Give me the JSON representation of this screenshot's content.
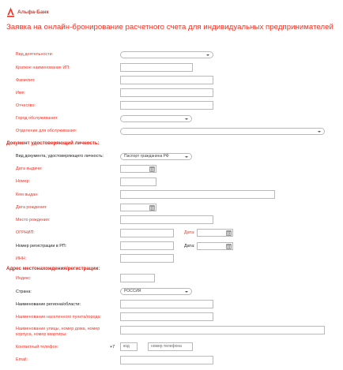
{
  "brand": {
    "name": "Альфа-Банк",
    "accent": "#ef3124"
  },
  "title": "Заявка на онлайн-бронирование расчетного счета для индивидуальных предпринимателей",
  "labels": {
    "activity": "Вид деятельности:",
    "short_name": "Краткое наименование ИП:",
    "surname": "Фамилия:",
    "name": "Имя:",
    "patronymic": "Отчество:",
    "city": "Город обслуживания:",
    "branch": "Отделение для обслуживания:",
    "id_section": "Документ удостоверяющий личность:",
    "doc_type": "Вид документа, удостоверяющего личность:",
    "issue_date": "Дата выдачи:",
    "number": "Номер:",
    "issued_by": "Кем выдан:",
    "birth_date": "Дата рождения:",
    "birth_place": "Место рождения:",
    "ogrnip": "ОГРНИП:",
    "date1": "Дата:",
    "reg_number": "Номер регистрации в РП:",
    "date2": "Дата:",
    "inn": "ИНН:",
    "address_section": "Адрес местонахождения/регистрации:",
    "index": "Индекс:",
    "country": "Страна:",
    "region": "Наименование региона/области:",
    "locality": "Наименование населенного пункта/города:",
    "street": "Наименование улицы, номер дома, номер корпуса, номер квартиры:",
    "phone": "Контактный телефон:",
    "email": "Email:"
  },
  "values": {
    "doc_type": "Паспорт гражданина РФ",
    "country": "РОССИЯ",
    "phone_prefix": "+7"
  },
  "placeholders": {
    "phone_code": "код",
    "phone_number": "номер телефона"
  }
}
